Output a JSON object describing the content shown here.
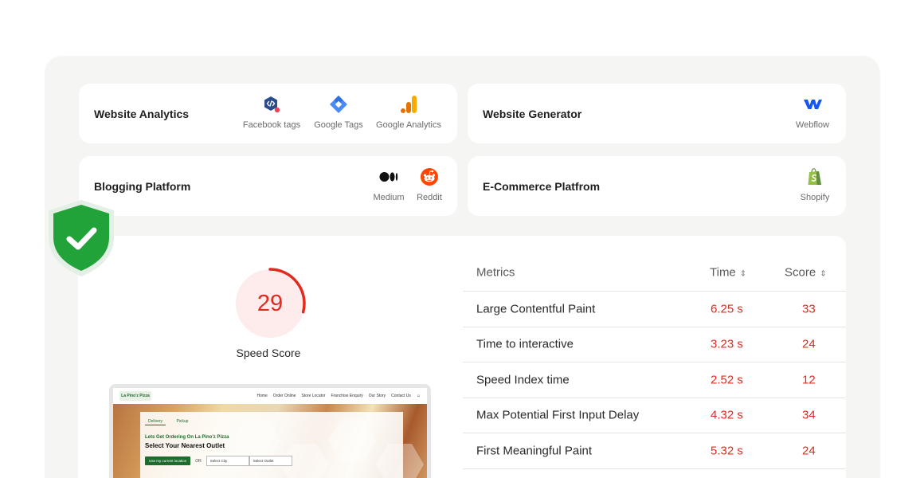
{
  "integrations": [
    {
      "title": "Website Analytics",
      "tools": [
        {
          "icon": "facebook-tags-icon",
          "label": "Facebook tags"
        },
        {
          "icon": "google-tags-icon",
          "label": "Google Tags"
        },
        {
          "icon": "google-analytics-icon",
          "label": "Google Analytics"
        }
      ]
    },
    {
      "title": "Website Generator",
      "tools": [
        {
          "icon": "webflow-icon",
          "label": "Webflow"
        }
      ]
    },
    {
      "title": "Blogging Platform",
      "tools": [
        {
          "icon": "medium-icon",
          "label": "Medium"
        },
        {
          "icon": "reddit-icon",
          "label": "Reddit"
        }
      ]
    },
    {
      "title": "E-Commerce Platfrom",
      "tools": [
        {
          "icon": "shopify-icon",
          "label": "Shopify"
        }
      ]
    }
  ],
  "badge": {
    "icon": "shield-check-icon",
    "color": "#22a33a"
  },
  "speed": {
    "score": "29",
    "score_fraction": 0.29,
    "label": "Speed Score",
    "color": "#e02b20"
  },
  "preview": {
    "logo": "La Pino'z Pizza",
    "nav": [
      "Home",
      "Order Online",
      "Store Locator",
      "Franchise Enquiry",
      "Our Story",
      "Contact Us"
    ],
    "tabs": [
      "Delivery",
      "Pickup"
    ],
    "subtitle": "Lets Get Ordering On La Pino'z Pizza",
    "heading": "Select Your Nearest Outlet",
    "location_button": "Use my current location",
    "or": "OR",
    "select_city": "Select City",
    "select_outlet": "Select Outlet"
  },
  "metrics": {
    "headers": {
      "metric": "Metrics",
      "time": "Time",
      "score": "Score"
    },
    "rows": [
      {
        "name": "Large Contentful Paint",
        "time": "6.25 s",
        "score": "33"
      },
      {
        "name": "Time to interactive",
        "time": "3.23 s",
        "score": "24"
      },
      {
        "name": "Speed Index time",
        "time": "2.52 s",
        "score": "12"
      },
      {
        "name": "Max Potential First Input Delay",
        "time": "4.32 s",
        "score": "34"
      },
      {
        "name": "First Meaningful Paint",
        "time": "5.32 s",
        "score": "24"
      }
    ]
  }
}
